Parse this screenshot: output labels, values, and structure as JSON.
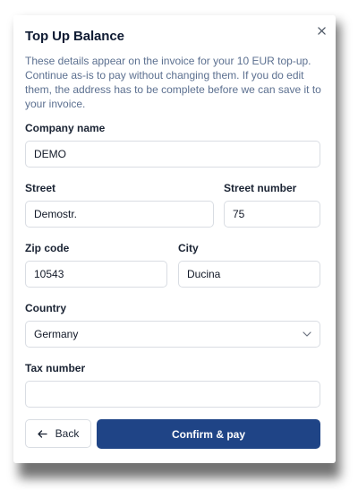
{
  "dialog": {
    "title": "Top Up Balance",
    "description": "These details appear on the invoice for your 10 EUR top-up. Continue as-is to pay without changing them. If you do edit them, the address has to be complete before we can save it to your invoice."
  },
  "form": {
    "company_name": {
      "label": "Company name",
      "value": "DEMO"
    },
    "street": {
      "label": "Street",
      "value": "Demostr."
    },
    "street_number": {
      "label": "Street number",
      "value": "75"
    },
    "zip_code": {
      "label": "Zip code",
      "value": "10543"
    },
    "city": {
      "label": "City",
      "value": "Ducina"
    },
    "country": {
      "label": "Country",
      "value": "Germany"
    },
    "tax_number": {
      "label": "Tax number",
      "value": ""
    }
  },
  "actions": {
    "back_label": "Back",
    "confirm_label": "Confirm & pay"
  },
  "icons": {
    "close": "close-icon",
    "back": "arrow-left-icon",
    "dropdown": "chevron-down-icon"
  },
  "colors": {
    "primary": "#1f4486",
    "description_text": "#5c7090",
    "border": "#d9dde3"
  }
}
